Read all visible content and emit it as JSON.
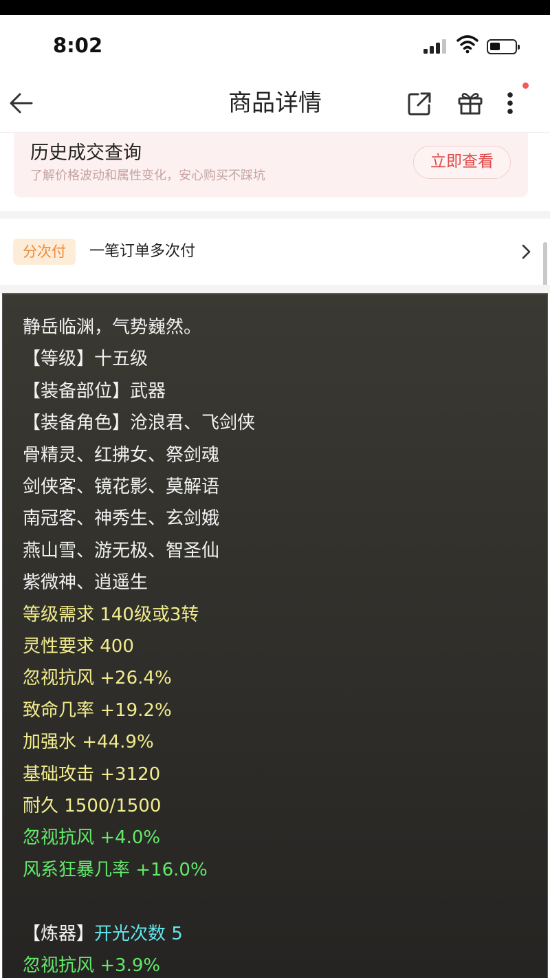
{
  "status_bar": {
    "time": "8:02"
  },
  "nav": {
    "title": "商品详情"
  },
  "history": {
    "title": "历史成交查询",
    "subtitle": "了解价格波动和属性变化，安心购买不踩坑",
    "button": "立即查看"
  },
  "payment": {
    "tag": "分次付",
    "text": "一笔订单多次付"
  },
  "item": {
    "desc": "静岳临渊，气势巍然。",
    "level": "【等级】十五级",
    "slot": "【装备部位】武器",
    "roles": [
      "【装备角色】沧浪君、飞剑侠",
      "骨精灵、红拂女、祭剑魂",
      "剑侠客、镜花影、莫解语",
      "南冠客、神秀生、玄剑娥",
      "燕山雪、游无极、智圣仙",
      "紫微神、逍遥生"
    ],
    "reqs": [
      "等级需求 140级或3转",
      "灵性要求 400"
    ],
    "stats": [
      "忽视抗风 +26.4%",
      "致命几率 +19.2%",
      "加强水 +44.9%",
      "基础攻击 +3120",
      "耐久 1500/1500"
    ],
    "extra": [
      "忽视抗风 +4.0%",
      "风系狂暴几率 +16.0%"
    ],
    "refine_prefix": "【炼器】",
    "refine_value": "开光次数 5",
    "refine_stat": "忽视抗风 +3.9%"
  },
  "colors": {
    "white": "#f2f2f2",
    "yellow": "#f2ec8e",
    "green": "#62e86a",
    "cyan": "#62e6ec",
    "accent_red": "#e04a4a",
    "tag_orange": "#f08a3a"
  }
}
